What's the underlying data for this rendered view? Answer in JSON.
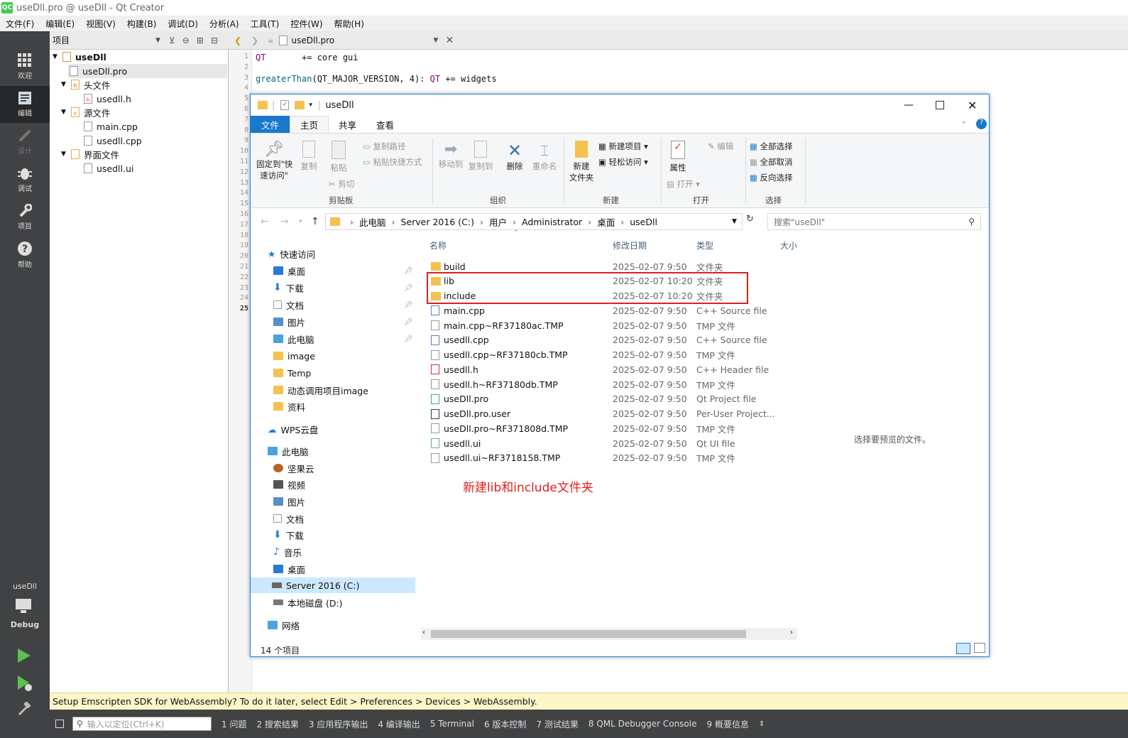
{
  "window": {
    "title": "useDll.pro @ useDll - Qt Creator",
    "logo": "QC"
  },
  "menu": [
    "文件(F)",
    "编辑(E)",
    "视图(V)",
    "构建(B)",
    "调试(D)",
    "分析(A)",
    "工具(T)",
    "控件(W)",
    "帮助(H)"
  ],
  "modes": {
    "welcome": "欢迎",
    "edit": "编辑",
    "design": "设计",
    "debug": "调试",
    "projects": "项目",
    "help": "帮助"
  },
  "kit": {
    "project": "useDll",
    "config": "Debug"
  },
  "project_panel": {
    "title": "项目"
  },
  "tree": {
    "root": "useDll",
    "pro": "useDll.pro",
    "headers": "头文件",
    "header_file": "usedll.h",
    "sources": "源文件",
    "src1": "main.cpp",
    "src2": "usedll.cpp",
    "forms": "界面文件",
    "form1": "usedll.ui"
  },
  "editor": {
    "tab": "useDll.pro",
    "line1_kw": "QT",
    "line1_rest": "       += core gui",
    "line3_fn": "greaterThan",
    "line3_arg": "(QT_MAJOR_VERSION, 4): ",
    "line3_kw": "QT",
    "line3_rest": " += widgets",
    "line_numbers": [
      "1",
      "2",
      "3",
      "4",
      "5",
      "6",
      "7",
      "8",
      "9",
      "10",
      "11",
      "12",
      "13",
      "14",
      "15",
      "16",
      "17",
      "18",
      "19",
      "20",
      "21",
      "22",
      "23",
      "24",
      "25"
    ]
  },
  "explorer": {
    "title": "useDll",
    "tabs": {
      "file": "文件",
      "home": "主页",
      "share": "共享",
      "view": "查看"
    },
    "ribbon": {
      "pin": "固定到\"快\n速访问\"",
      "copy": "复制",
      "paste": "粘贴",
      "copy_path": "复制路径",
      "paste_shortcut": "粘贴快捷方式",
      "cut": "剪切",
      "clipboard": "剪贴板",
      "move_to": "移动到",
      "copy_to": "复制到",
      "delete": "删除",
      "rename": "重命名",
      "organize": "组织",
      "new_folder": "新建\n文件夹",
      "new_item": "新建项目 ▾",
      "easy_access": "轻松访问 ▾",
      "new": "新建",
      "properties": "属性",
      "open": "打开 ▾",
      "edit": "编辑",
      "open_group": "打开",
      "select_all": "全部选择",
      "select_none": "全部取消",
      "invert": "反向选择",
      "select": "选择"
    },
    "address": [
      "此电脑",
      "Server 2016 (C:)",
      "用户",
      "Administrator",
      "桌面",
      "useDll"
    ],
    "search_placeholder": "搜索\"useDll\"",
    "nav": {
      "quick_access": "快速访问",
      "desktop": "桌面",
      "downloads": "下载",
      "documents": "文档",
      "pictures": "图片",
      "this_pc": "此电脑",
      "image": "image",
      "temp": "Temp",
      "dyn": "动态调用项目image",
      "res": "资料",
      "wps": "WPS云盘",
      "thispc2": "此电脑",
      "jianguoyun": "坚果云",
      "videos": "视频",
      "pictures2": "图片",
      "documents2": "文档",
      "downloads2": "下载",
      "music": "音乐",
      "desktop2": "桌面",
      "c_drive": "Server 2016 (C:)",
      "d_drive": "本地磁盘 (D:)",
      "network": "网络"
    },
    "columns": {
      "name": "名称",
      "date": "修改日期",
      "type": "类型",
      "size": "大小"
    },
    "files": [
      {
        "name": "build",
        "date": "2025-02-07 9:50",
        "type": "文件夹",
        "kind": "folder"
      },
      {
        "name": "lib",
        "date": "2025-02-07 10:20",
        "type": "文件夹",
        "kind": "folder"
      },
      {
        "name": "include",
        "date": "2025-02-07 10:20",
        "type": "文件夹",
        "kind": "folder"
      },
      {
        "name": "main.cpp",
        "date": "2025-02-07 9:50",
        "type": "C++ Source file",
        "kind": "cpp"
      },
      {
        "name": "main.cpp~RF37180ac.TMP",
        "date": "2025-02-07 9:50",
        "type": "TMP 文件",
        "kind": "file"
      },
      {
        "name": "usedll.cpp",
        "date": "2025-02-07 9:50",
        "type": "C++ Source file",
        "kind": "cpp"
      },
      {
        "name": "usedll.cpp~RF37180cb.TMP",
        "date": "2025-02-07 9:50",
        "type": "TMP 文件",
        "kind": "file"
      },
      {
        "name": "usedll.h",
        "date": "2025-02-07 9:50",
        "type": "C++ Header file",
        "kind": "h"
      },
      {
        "name": "usedll.h~RF37180db.TMP",
        "date": "2025-02-07 9:50",
        "type": "TMP 文件",
        "kind": "file"
      },
      {
        "name": "useDll.pro",
        "date": "2025-02-07 9:50",
        "type": "Qt Project file",
        "kind": "pro"
      },
      {
        "name": "useDll.pro.user",
        "date": "2025-02-07 9:50",
        "type": "Per-User Project...",
        "kind": "user"
      },
      {
        "name": "useDll.pro~RF371808d.TMP",
        "date": "2025-02-07 9:50",
        "type": "TMP 文件",
        "kind": "file"
      },
      {
        "name": "usedll.ui",
        "date": "2025-02-07 9:50",
        "type": "Qt UI file",
        "kind": "ui"
      },
      {
        "name": "usedll.ui~RF3718158.TMP",
        "date": "2025-02-07 9:50",
        "type": "TMP 文件",
        "kind": "file"
      }
    ],
    "status": "14 个项目",
    "preview": "选择要预览的文件。"
  },
  "annotation": "新建lib和include文件夹",
  "infobar": "Setup Emscripten SDK for WebAssembly? To do it later, select Edit > Preferences > Devices > WebAssembly.",
  "bottom": {
    "locator_placeholder": "输入以定位(Ctrl+K)",
    "tabs": [
      "1 问题",
      "2 搜索结果",
      "3 应用程序输出",
      "4 编译输出",
      "5 Terminal",
      "6 版本控制",
      "7 测试结果",
      "8 QML Debugger Console",
      "9 概要信息"
    ]
  },
  "colors": {
    "accent": "#1979ca",
    "annotation": "#e02020",
    "modebar": "#404244"
  }
}
